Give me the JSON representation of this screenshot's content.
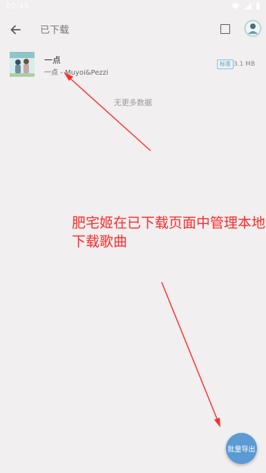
{
  "status": {
    "time": "10:45"
  },
  "appbar": {
    "title": "已下载"
  },
  "songs": [
    {
      "title": "一点",
      "subtitle": "一点 - Muyoi&Pezzi",
      "quality": "标准",
      "size": "3.1 MB"
    }
  ],
  "list": {
    "end_text": "无更多数据"
  },
  "annotation": {
    "text": "肥宅姬在已下载页面中管理本地下载歌曲"
  },
  "fab": {
    "label": "批量导出"
  },
  "colors": {
    "accent": "#5b9ad3",
    "annotation": "#ff2b2b",
    "background": "#f1efef"
  }
}
